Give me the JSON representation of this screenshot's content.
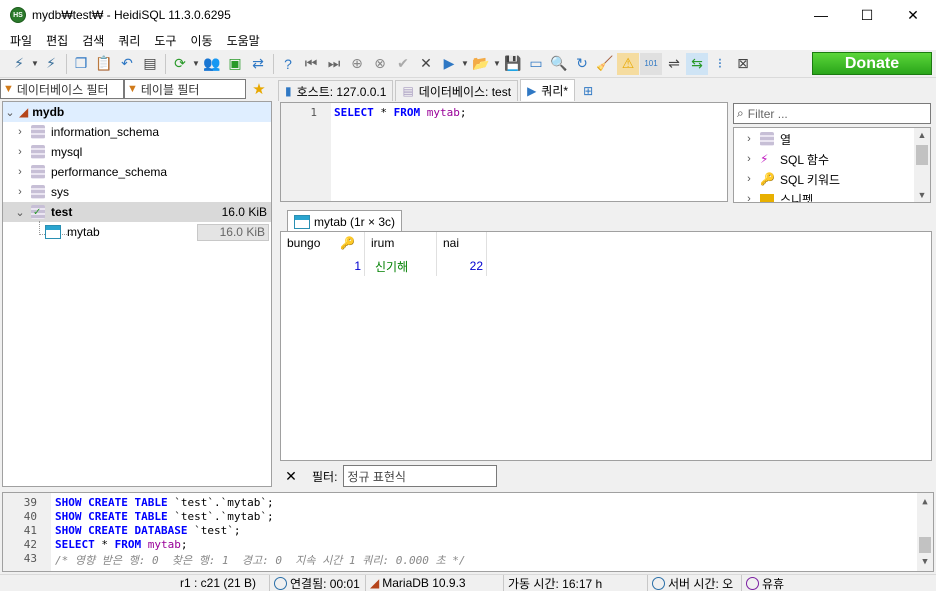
{
  "window": {
    "app_icon_text": "HS",
    "title": "mydb₩test₩ - HeidiSQL 11.3.0.6295",
    "minimize": "—",
    "maximize": "☐",
    "close": "✕"
  },
  "menu": [
    "파일",
    "편집",
    "검색",
    "쿼리",
    "도구",
    "이동",
    "도움말"
  ],
  "toolbar": {
    "donate_label": "Donate"
  },
  "left_panel": {
    "db_filter_placeholder": "데이터베이스 필터",
    "table_filter_placeholder": "테이블 필터",
    "tree": {
      "root": "mydb",
      "databases": [
        {
          "name": "information_schema",
          "size": ""
        },
        {
          "name": "mysql",
          "size": ""
        },
        {
          "name": "performance_schema",
          "size": ""
        },
        {
          "name": "sys",
          "size": ""
        },
        {
          "name": "test",
          "size": "16.0 KiB"
        }
      ],
      "tables": [
        {
          "name": "mytab",
          "size": "16.0 KiB"
        }
      ]
    }
  },
  "tabs": [
    {
      "label": "호스트: 127.0.0.1",
      "active": false
    },
    {
      "label": "데이터베이스: test",
      "active": false
    },
    {
      "label": "쿼리*",
      "active": true
    }
  ],
  "editor": {
    "line_no": "1",
    "kw1": "SELECT",
    "star": "*",
    "kw2": "FROM",
    "table": "mytab",
    "semi": ";"
  },
  "helper": {
    "filter_placeholder": "Filter ...",
    "items": [
      "열",
      "SQL 함수",
      "SQL 키워드",
      "스니펫"
    ]
  },
  "result": {
    "tab_label": "mytab (1r × 3c)",
    "columns": [
      "bungo",
      "irum",
      "nai"
    ],
    "rows": [
      {
        "bungo": "1",
        "irum": "신기해",
        "nai": "22"
      }
    ]
  },
  "filterbar": {
    "close": "✕",
    "label": "필터:",
    "placeholder": "정규 표현식"
  },
  "log": {
    "lines": [
      {
        "no": "39",
        "text": "SHOW CREATE TABLE `test`.`mytab`;"
      },
      {
        "no": "40",
        "text": "SHOW CREATE TABLE `test`.`mytab`;"
      },
      {
        "no": "41",
        "text": "SHOW CREATE DATABASE `test`;"
      },
      {
        "no": "42",
        "text": "SELECT * FROM mytab;"
      },
      {
        "no": "43",
        "text": "/* 영향 받은 행: 0  찾은 행: 1  경고: 0  지속 시간 1 쿼리: 0.000 초 */"
      }
    ]
  },
  "status": {
    "cursor": "r1 : c21 (21 B)",
    "connected": "연결됨: 00:01",
    "server": "MariaDB 10.9.3",
    "uptime": "가동 시간: 16:17 h",
    "server_time": "서버 시간: 오",
    "idle": "유휴"
  },
  "colors": {
    "keyword": "#0000ff",
    "identifier": "#990099",
    "donate": "#2aa51a"
  }
}
